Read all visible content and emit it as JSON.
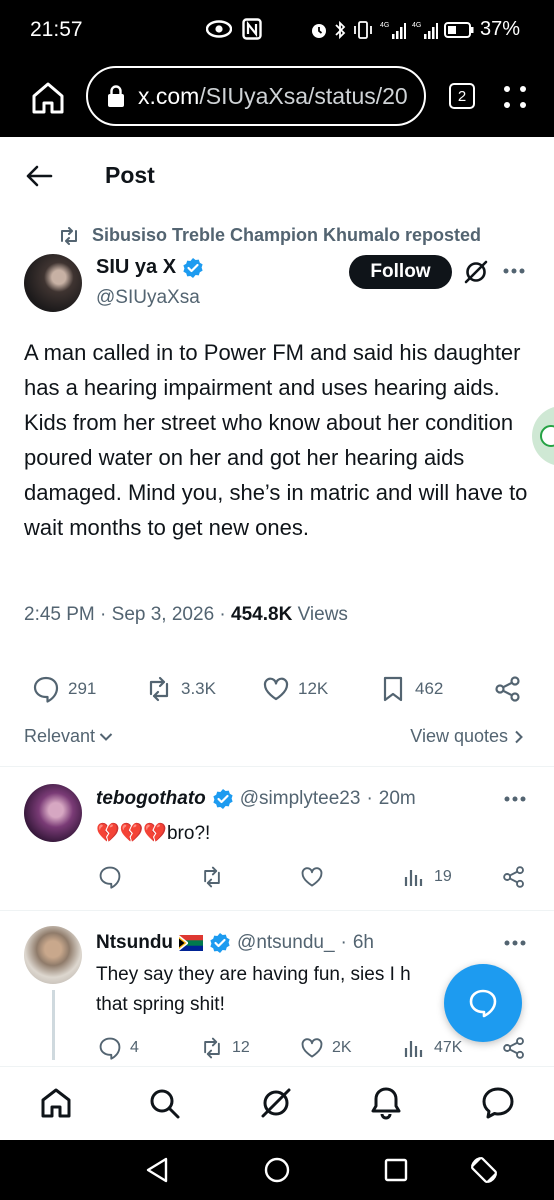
{
  "status_bar": {
    "time": "21:57",
    "battery_pct": "37%"
  },
  "browser": {
    "url_host": "x.com",
    "url_path": "/SIUyaXsa/status/20",
    "tab_count": "2"
  },
  "header": {
    "title": "Post"
  },
  "post": {
    "reposted_by": "Sibusiso Treble Champion Khumalo reposted",
    "author_name": "SIU ya X",
    "author_handle": "@SIUyaXsa",
    "follow_label": "Follow",
    "text": "A man called in to Power FM and said his daughter has a hearing impairment and uses hearing aids. Kids from her street who know about her condition poured water on her and got her hearing aids damaged. Mind you, she’s in matric and will have to wait months to get new ones.",
    "time": "2:45 PM",
    "date": "Sep 3, 2026",
    "views_count": "454.8K",
    "views_label": "Views",
    "stats": {
      "replies": "291",
      "reposts": "3.3K",
      "likes": "12K",
      "bookmarks": "462"
    }
  },
  "sort": {
    "relevant_label": "Relevant",
    "view_quotes_label": "View quotes"
  },
  "replies": [
    {
      "name": "tebogothato",
      "handle": "@simplytee23",
      "time": "20m",
      "text": "bro?!",
      "emoji": "💔💔💔",
      "stats": {
        "views": "19"
      }
    },
    {
      "name": "Ntsundu",
      "handle": "@ntsundu_",
      "time": "6h",
      "text_line1": "They say they are having fun, sies I h",
      "text_line2": "that spring shit!",
      "stats": {
        "replies": "4",
        "reposts": "12",
        "likes": "2K",
        "views": "47K"
      }
    }
  ],
  "colors": {
    "accent": "#1d9bf0",
    "verified": "#1d9bf0",
    "text_secondary": "#536471"
  }
}
